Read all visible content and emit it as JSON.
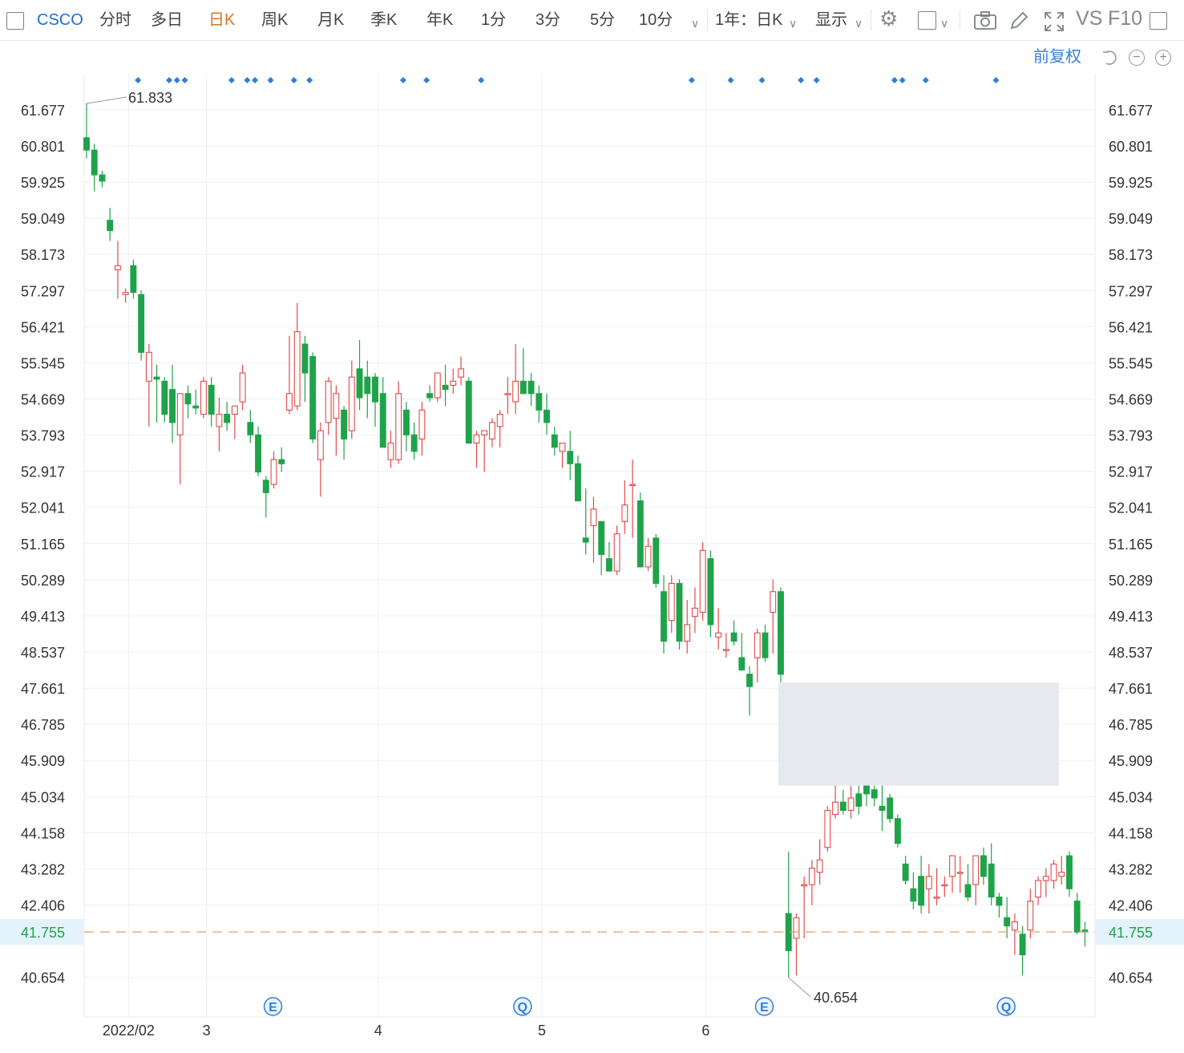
{
  "toolbar": {
    "symbol": "CSCO",
    "tabs": [
      "分时",
      "多日",
      "日K",
      "周K",
      "月K",
      "季K",
      "年K",
      "1分",
      "3分",
      "5分",
      "10分"
    ],
    "active_tab": "日K",
    "period": "1年：日K",
    "display": "显示",
    "vs": "VS",
    "f10": "F10",
    "restore": "前复权"
  },
  "colors": {
    "up": "#e14a4a",
    "down": "#1fa34a",
    "axis_text": "#333333",
    "grid": "#eef0f3",
    "current_line": "#e0a060",
    "marker": "#2f7fd6"
  },
  "chart_data": {
    "type": "candlestick",
    "ylim": [
      40.2,
      62.55
    ],
    "y_ticks": [
      "61.677",
      "60.801",
      "59.925",
      "59.049",
      "58.173",
      "57.297",
      "56.421",
      "55.545",
      "54.669",
      "53.793",
      "52.917",
      "52.041",
      "51.165",
      "50.289",
      "49.413",
      "48.537",
      "47.661",
      "46.785",
      "45.909",
      "45.034",
      "44.158",
      "43.282",
      "42.406",
      "40.654"
    ],
    "x_labels": [
      {
        "label": "2022/02",
        "index": 6
      },
      {
        "label": "3",
        "index": 16
      },
      {
        "label": "4",
        "index": 38
      },
      {
        "label": "5",
        "index": 59
      },
      {
        "label": "6",
        "index": 80
      }
    ],
    "current_price": "41.755",
    "max_label": "61.833",
    "min_label": "40.654",
    "event_markers": [
      {
        "symbol": "E",
        "index": 24
      },
      {
        "symbol": "Q",
        "index": 56
      },
      {
        "symbol": "E",
        "index": 87
      },
      {
        "symbol": "Q",
        "index": 118
      }
    ],
    "dots": [
      7,
      11,
      12,
      13,
      19,
      21,
      22,
      24,
      27,
      29,
      41,
      44,
      51,
      78,
      83,
      87,
      92,
      94,
      104,
      105,
      108,
      117
    ],
    "candles": [
      {
        "o": 61.0,
        "h": 61.83,
        "l": 60.5,
        "c": 60.7
      },
      {
        "o": 60.7,
        "h": 60.85,
        "l": 59.7,
        "c": 60.1
      },
      {
        "o": 60.1,
        "h": 60.2,
        "l": 59.8,
        "c": 59.95
      },
      {
        "o": 59.0,
        "h": 59.3,
        "l": 58.5,
        "c": 58.75
      },
      {
        "o": 57.8,
        "h": 58.5,
        "l": 57.1,
        "c": 57.9
      },
      {
        "o": 57.2,
        "h": 57.35,
        "l": 57.0,
        "c": 57.25
      },
      {
        "o": 57.9,
        "h": 58.05,
        "l": 57.1,
        "c": 57.25
      },
      {
        "o": 57.2,
        "h": 57.3,
        "l": 55.6,
        "c": 55.8
      },
      {
        "o": 55.1,
        "h": 56.0,
        "l": 54.0,
        "c": 55.8
      },
      {
        "o": 55.2,
        "h": 55.5,
        "l": 54.1,
        "c": 55.15
      },
      {
        "o": 55.1,
        "h": 55.2,
        "l": 54.1,
        "c": 54.3
      },
      {
        "o": 54.9,
        "h": 55.5,
        "l": 53.6,
        "c": 54.1
      },
      {
        "o": 53.8,
        "h": 54.8,
        "l": 52.6,
        "c": 54.8
      },
      {
        "o": 54.8,
        "h": 55.0,
        "l": 54.2,
        "c": 54.55
      },
      {
        "o": 54.5,
        "h": 54.9,
        "l": 54.3,
        "c": 54.45
      },
      {
        "o": 54.3,
        "h": 55.2,
        "l": 54.2,
        "c": 55.1
      },
      {
        "o": 55.0,
        "h": 55.2,
        "l": 54.0,
        "c": 54.3
      },
      {
        "o": 54.0,
        "h": 54.7,
        "l": 53.4,
        "c": 54.3
      },
      {
        "o": 54.3,
        "h": 54.6,
        "l": 53.9,
        "c": 54.1
      },
      {
        "o": 54.3,
        "h": 54.5,
        "l": 53.7,
        "c": 54.5
      },
      {
        "o": 54.6,
        "h": 55.5,
        "l": 54.4,
        "c": 55.3
      },
      {
        "o": 54.1,
        "h": 54.4,
        "l": 53.6,
        "c": 53.8
      },
      {
        "o": 53.8,
        "h": 54.0,
        "l": 52.8,
        "c": 52.9
      },
      {
        "o": 52.7,
        "h": 52.8,
        "l": 51.8,
        "c": 52.4
      },
      {
        "o": 52.6,
        "h": 53.4,
        "l": 52.5,
        "c": 53.2
      },
      {
        "o": 53.2,
        "h": 53.5,
        "l": 52.9,
        "c": 53.1
      },
      {
        "o": 54.4,
        "h": 56.2,
        "l": 54.3,
        "c": 54.8
      },
      {
        "o": 54.5,
        "h": 57.0,
        "l": 54.4,
        "c": 56.3
      },
      {
        "o": 56.0,
        "h": 56.2,
        "l": 54.6,
        "c": 55.3
      },
      {
        "o": 55.7,
        "h": 55.8,
        "l": 53.6,
        "c": 53.7
      },
      {
        "o": 53.2,
        "h": 54.1,
        "l": 52.3,
        "c": 53.9
      },
      {
        "o": 54.1,
        "h": 55.2,
        "l": 53.8,
        "c": 55.1
      },
      {
        "o": 54.2,
        "h": 55.0,
        "l": 53.3,
        "c": 54.8
      },
      {
        "o": 54.4,
        "h": 54.5,
        "l": 53.2,
        "c": 53.7
      },
      {
        "o": 53.9,
        "h": 55.6,
        "l": 53.7,
        "c": 55.2
      },
      {
        "o": 55.4,
        "h": 56.1,
        "l": 54.4,
        "c": 54.7
      },
      {
        "o": 55.2,
        "h": 55.6,
        "l": 54.2,
        "c": 54.8
      },
      {
        "o": 55.2,
        "h": 55.3,
        "l": 54.0,
        "c": 54.6
      },
      {
        "o": 54.8,
        "h": 55.2,
        "l": 53.5,
        "c": 53.5
      },
      {
        "o": 53.2,
        "h": 53.9,
        "l": 53.0,
        "c": 53.6
      },
      {
        "o": 53.2,
        "h": 55.1,
        "l": 53.1,
        "c": 54.8
      },
      {
        "o": 54.4,
        "h": 54.6,
        "l": 53.4,
        "c": 53.8
      },
      {
        "o": 53.8,
        "h": 54.1,
        "l": 53.2,
        "c": 53.4
      },
      {
        "o": 53.7,
        "h": 54.6,
        "l": 53.3,
        "c": 54.4
      },
      {
        "o": 54.8,
        "h": 55.0,
        "l": 54.6,
        "c": 54.7
      },
      {
        "o": 54.7,
        "h": 55.3,
        "l": 54.6,
        "c": 55.3
      },
      {
        "o": 55.0,
        "h": 55.5,
        "l": 54.5,
        "c": 54.9
      },
      {
        "o": 55.0,
        "h": 55.4,
        "l": 54.8,
        "c": 55.1
      },
      {
        "o": 55.2,
        "h": 55.7,
        "l": 55.0,
        "c": 55.4
      },
      {
        "o": 55.1,
        "h": 55.2,
        "l": 53.7,
        "c": 53.6
      },
      {
        "o": 53.6,
        "h": 53.9,
        "l": 53.0,
        "c": 53.8
      },
      {
        "o": 53.8,
        "h": 53.9,
        "l": 52.9,
        "c": 53.9
      },
      {
        "o": 53.7,
        "h": 54.2,
        "l": 53.5,
        "c": 54.1
      },
      {
        "o": 54.0,
        "h": 54.4,
        "l": 53.5,
        "c": 54.3
      },
      {
        "o": 54.8,
        "h": 55.2,
        "l": 54.3,
        "c": 54.8
      },
      {
        "o": 54.6,
        "h": 56.0,
        "l": 54.3,
        "c": 55.1
      },
      {
        "o": 55.1,
        "h": 55.9,
        "l": 54.9,
        "c": 54.8
      },
      {
        "o": 55.1,
        "h": 55.3,
        "l": 54.5,
        "c": 54.8
      },
      {
        "o": 54.8,
        "h": 55.0,
        "l": 54.1,
        "c": 54.4
      },
      {
        "o": 54.4,
        "h": 54.8,
        "l": 53.8,
        "c": 54.1
      },
      {
        "o": 53.8,
        "h": 54.0,
        "l": 53.3,
        "c": 53.5
      },
      {
        "o": 53.4,
        "h": 53.6,
        "l": 53.0,
        "c": 53.6
      },
      {
        "o": 53.4,
        "h": 53.9,
        "l": 52.7,
        "c": 53.1
      },
      {
        "o": 53.1,
        "h": 53.3,
        "l": 52.4,
        "c": 52.2
      },
      {
        "o": 51.3,
        "h": 52.5,
        "l": 50.9,
        "c": 51.2
      },
      {
        "o": 51.6,
        "h": 52.3,
        "l": 50.7,
        "c": 52.0
      },
      {
        "o": 51.7,
        "h": 51.7,
        "l": 50.4,
        "c": 50.9
      },
      {
        "o": 50.8,
        "h": 51.2,
        "l": 50.5,
        "c": 50.5
      },
      {
        "o": 50.5,
        "h": 51.6,
        "l": 50.4,
        "c": 51.4
      },
      {
        "o": 51.7,
        "h": 52.7,
        "l": 51.4,
        "c": 52.1
      },
      {
        "o": 52.6,
        "h": 53.2,
        "l": 51.3,
        "c": 52.6
      },
      {
        "o": 52.2,
        "h": 52.4,
        "l": 50.9,
        "c": 50.6
      },
      {
        "o": 50.6,
        "h": 51.3,
        "l": 50.5,
        "c": 51.1
      },
      {
        "o": 51.3,
        "h": 51.4,
        "l": 50.1,
        "c": 50.2
      },
      {
        "o": 50.0,
        "h": 50.4,
        "l": 48.5,
        "c": 48.8
      },
      {
        "o": 49.3,
        "h": 50.4,
        "l": 49.0,
        "c": 50.2
      },
      {
        "o": 50.2,
        "h": 50.3,
        "l": 48.6,
        "c": 48.8
      },
      {
        "o": 48.8,
        "h": 49.8,
        "l": 48.5,
        "c": 49.2
      },
      {
        "o": 49.4,
        "h": 50.1,
        "l": 49.0,
        "c": 49.6
      },
      {
        "o": 49.5,
        "h": 51.2,
        "l": 49.3,
        "c": 51.0
      },
      {
        "o": 50.8,
        "h": 51.0,
        "l": 48.9,
        "c": 49.2
      },
      {
        "o": 48.9,
        "h": 49.6,
        "l": 48.6,
        "c": 49.0
      },
      {
        "o": 48.6,
        "h": 49.0,
        "l": 48.4,
        "c": 48.6
      },
      {
        "o": 49.0,
        "h": 49.3,
        "l": 48.7,
        "c": 48.8
      },
      {
        "o": 48.4,
        "h": 49.0,
        "l": 48.1,
        "c": 48.1
      },
      {
        "o": 48.0,
        "h": 48.2,
        "l": 47.0,
        "c": 47.7
      },
      {
        "o": 48.4,
        "h": 49.1,
        "l": 47.8,
        "c": 49.0
      },
      {
        "o": 49.0,
        "h": 49.2,
        "l": 48.3,
        "c": 48.4
      },
      {
        "o": 49.5,
        "h": 50.3,
        "l": 48.5,
        "c": 50.0
      },
      {
        "o": 50.0,
        "h": 50.1,
        "l": 47.8,
        "c": 48.0
      },
      {
        "o": 42.2,
        "h": 43.7,
        "l": 40.65,
        "c": 41.3
      },
      {
        "o": 41.6,
        "h": 42.2,
        "l": 40.7,
        "c": 42.1
      },
      {
        "o": 42.9,
        "h": 43.1,
        "l": 41.6,
        "c": 42.9
      },
      {
        "o": 42.9,
        "h": 43.5,
        "l": 42.4,
        "c": 43.3
      },
      {
        "o": 43.2,
        "h": 44.0,
        "l": 42.9,
        "c": 43.5
      },
      {
        "o": 43.8,
        "h": 44.8,
        "l": 43.7,
        "c": 44.7
      },
      {
        "o": 44.6,
        "h": 45.3,
        "l": 44.5,
        "c": 44.9
      },
      {
        "o": 44.9,
        "h": 45.2,
        "l": 44.6,
        "c": 44.7
      },
      {
        "o": 44.7,
        "h": 45.3,
        "l": 44.5,
        "c": 45.0
      },
      {
        "o": 45.1,
        "h": 45.4,
        "l": 44.6,
        "c": 44.8
      },
      {
        "o": 45.3,
        "h": 45.4,
        "l": 44.8,
        "c": 45.1
      },
      {
        "o": 45.2,
        "h": 45.8,
        "l": 44.8,
        "c": 45.0
      },
      {
        "o": 44.8,
        "h": 45.4,
        "l": 44.2,
        "c": 44.7
      },
      {
        "o": 45.0,
        "h": 45.1,
        "l": 44.4,
        "c": 44.5
      },
      {
        "o": 44.5,
        "h": 44.6,
        "l": 43.8,
        "c": 43.9
      },
      {
        "o": 43.4,
        "h": 43.6,
        "l": 42.9,
        "c": 43.0
      },
      {
        "o": 42.8,
        "h": 43.2,
        "l": 42.3,
        "c": 42.5
      },
      {
        "o": 43.1,
        "h": 43.6,
        "l": 42.2,
        "c": 42.4
      },
      {
        "o": 42.8,
        "h": 43.4,
        "l": 42.2,
        "c": 43.1
      },
      {
        "o": 42.6,
        "h": 43.3,
        "l": 42.4,
        "c": 42.6
      },
      {
        "o": 42.9,
        "h": 43.1,
        "l": 42.6,
        "c": 42.9
      },
      {
        "o": 43.1,
        "h": 43.6,
        "l": 42.7,
        "c": 43.6
      },
      {
        "o": 43.2,
        "h": 43.6,
        "l": 42.7,
        "c": 43.2
      },
      {
        "o": 42.9,
        "h": 43.4,
        "l": 42.5,
        "c": 42.6
      },
      {
        "o": 42.9,
        "h": 43.5,
        "l": 42.4,
        "c": 43.6
      },
      {
        "o": 43.6,
        "h": 43.8,
        "l": 42.9,
        "c": 43.1
      },
      {
        "o": 43.4,
        "h": 43.9,
        "l": 42.4,
        "c": 42.6
      },
      {
        "o": 42.6,
        "h": 42.7,
        "l": 42.1,
        "c": 42.4
      },
      {
        "o": 42.1,
        "h": 42.6,
        "l": 41.6,
        "c": 41.9
      },
      {
        "o": 41.8,
        "h": 42.2,
        "l": 41.2,
        "c": 42.0
      },
      {
        "o": 41.7,
        "h": 41.9,
        "l": 40.7,
        "c": 41.2
      },
      {
        "o": 41.8,
        "h": 42.8,
        "l": 41.6,
        "c": 42.5
      },
      {
        "o": 42.6,
        "h": 43.1,
        "l": 42.4,
        "c": 43.0
      },
      {
        "o": 43.0,
        "h": 43.3,
        "l": 42.6,
        "c": 43.1
      },
      {
        "o": 43.0,
        "h": 43.5,
        "l": 42.8,
        "c": 43.4
      },
      {
        "o": 43.1,
        "h": 43.6,
        "l": 42.9,
        "c": 43.2
      },
      {
        "o": 43.6,
        "h": 43.7,
        "l": 42.6,
        "c": 42.8
      },
      {
        "o": 42.5,
        "h": 42.7,
        "l": 41.7,
        "c": 41.75
      },
      {
        "o": 41.8,
        "h": 42.0,
        "l": 41.4,
        "c": 41.75
      }
    ]
  }
}
